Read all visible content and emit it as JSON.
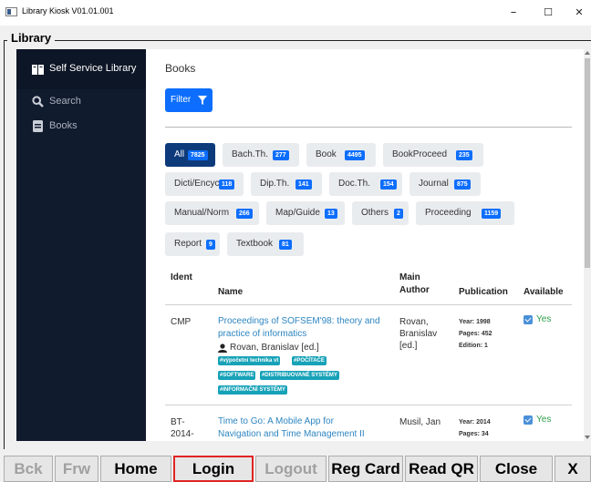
{
  "window": {
    "title": "Library Kiosk V01.01.001",
    "minimize": "–",
    "maximize": "☐",
    "close": "✕"
  },
  "group_title": "Library",
  "sidebar": {
    "brand": "Self Service Library",
    "items": [
      {
        "label": "Search",
        "icon": "search-icon"
      },
      {
        "label": "Books",
        "icon": "book-icon"
      }
    ]
  },
  "main": {
    "title": "Books",
    "filter_label": "Filter",
    "categories": [
      {
        "label": "All",
        "count": "7825",
        "active": true
      },
      {
        "label": "Bach.Th.",
        "count": "277"
      },
      {
        "label": "Book",
        "count": "4495"
      },
      {
        "label": "BookProceed",
        "count": "235"
      },
      {
        "label": "Dicti/Encyc",
        "count": "118"
      },
      {
        "label": "Dip.Th.",
        "count": "141"
      },
      {
        "label": "Doc.Th.",
        "count": "154"
      },
      {
        "label": "Journal",
        "count": "875"
      },
      {
        "label": "Manual/Norm",
        "count": "266"
      },
      {
        "label": "Map/Guide",
        "count": "13"
      },
      {
        "label": "Others",
        "count": "2"
      },
      {
        "label": "Proceeding",
        "count": "1159"
      },
      {
        "label": "Report",
        "count": "9"
      },
      {
        "label": "Textbook",
        "count": "81"
      }
    ],
    "table": {
      "headers": {
        "ident": "Ident",
        "name": "Name",
        "main_author_1": "Main",
        "main_author_2": "Author",
        "publication": "Publication",
        "available": "Available"
      },
      "rows": [
        {
          "ident": "CMP",
          "name_1": "Proceedings of SOFSEM'98: theory and",
          "name_2": "practice of informatics",
          "editor": "Rovan, Branislav [ed.]",
          "author_1": "Rovan,",
          "author_2": "Branislav",
          "author_3": "[ed.]",
          "year": "Year: 1998",
          "pages": "Pages: 452",
          "edition": "Edition: 1",
          "available": "Yes",
          "tags": [
            "#výpočetní technika vt",
            "#POČÍTAČE",
            "#SOFTWARE",
            "#DISTRIBUOVANÉ SYSTÉMY",
            "#INFORMAČNÍ SYSTÉMY"
          ]
        },
        {
          "ident_1": "BT-",
          "ident_2": "2014-",
          "name_1": "Time to Go: A Mobile App for",
          "name_2": "Navigation and Time Management II",
          "author_1": "Musil, Jan",
          "year": "Year: 2014",
          "pages": "Pages: 34",
          "available": "Yes"
        }
      ]
    }
  },
  "toolbar": {
    "back": "Bck",
    "forward": "Frw",
    "home": "Home",
    "login": "Login",
    "logout": "Logout",
    "reg_card": "Reg Card",
    "read_qr": "Read QR",
    "close": "Close",
    "exit": "X"
  },
  "colors": {
    "sidebar_bg": "#111b2e",
    "primary": "#0d6efd",
    "active_chip": "#0d3a7a",
    "link": "#2e86c1",
    "tag": "#17a2b8",
    "available": "#2e9e4a",
    "login_highlight": "#e02424"
  }
}
